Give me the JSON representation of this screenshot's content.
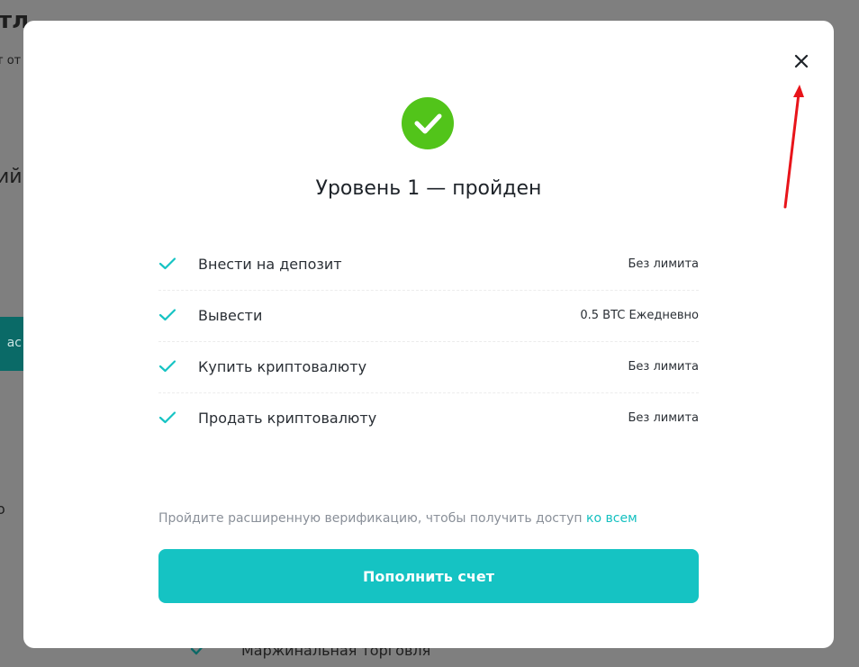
{
  "background": {
    "fragments": [
      "тл",
      "т от",
      "ий",
      "ас",
      "о"
    ],
    "bottom_item": "Маржинальная торговля"
  },
  "modal": {
    "title": "Уровень 1 — пройден",
    "limits": [
      {
        "label": "Внести на депозит",
        "value": "Без лимита"
      },
      {
        "label": "Вывести",
        "value": "0.5 BTC Ежедневно"
      },
      {
        "label": "Купить криптовалюту",
        "value": "Без лимита"
      },
      {
        "label": "Продать криптовалюту",
        "value": "Без лимита"
      }
    ],
    "hint_text": "Пройдите расширенную верификацию, чтобы получить доступ ",
    "hint_link": "ко всем",
    "cta_label": "Пополнить счет"
  },
  "icons": {
    "close": "close-icon",
    "success": "checkmark-circle-icon",
    "row_check": "checkmark-icon",
    "annotation": "red-arrow-annotation"
  },
  "colors": {
    "accent": "#15c3c3",
    "success": "#52c41a",
    "overlay": "#7f7f7f",
    "annotation": "#e8141a"
  }
}
